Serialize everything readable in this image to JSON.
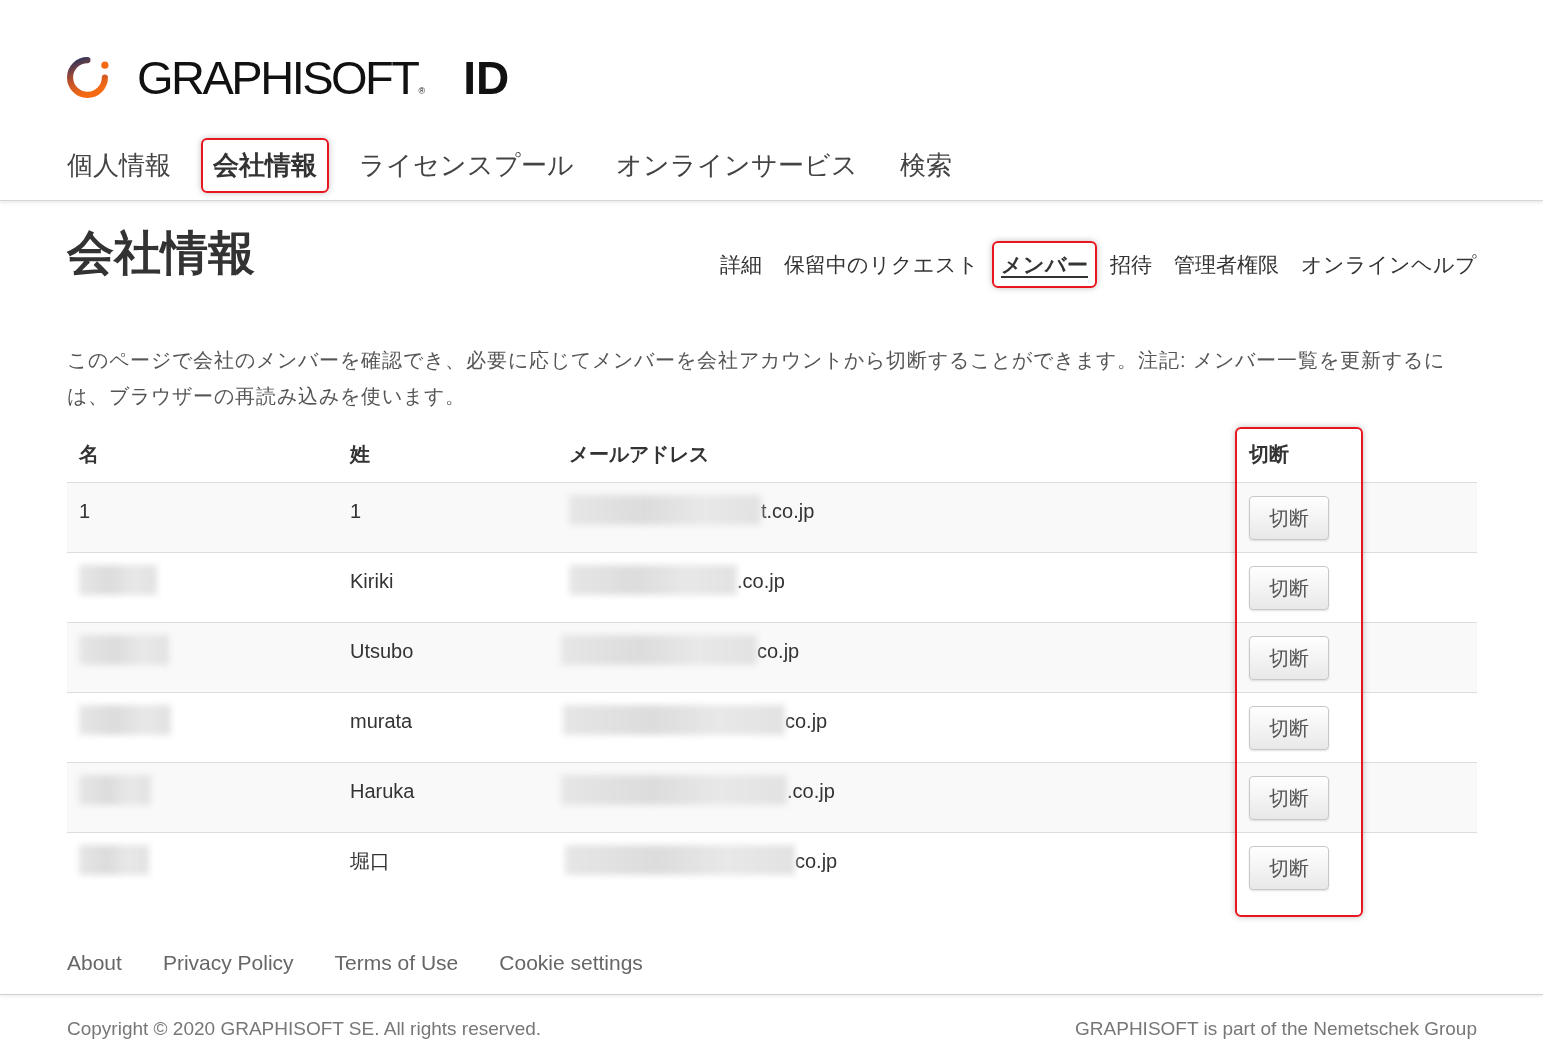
{
  "header": {
    "logo": {
      "wordmark": "GRAPHISOFT",
      "registered_mark": "®",
      "suffix": "ID"
    }
  },
  "nav_tabs": [
    {
      "label": "個人情報",
      "selected": false,
      "highlighted": false
    },
    {
      "label": "会社情報",
      "selected": true,
      "highlighted": true
    },
    {
      "label": "ライセンスプール",
      "selected": false,
      "highlighted": false
    },
    {
      "label": "オンラインサービス",
      "selected": false,
      "highlighted": false
    },
    {
      "label": "検索",
      "selected": false,
      "highlighted": false
    }
  ],
  "page": {
    "title": "会社情報",
    "subnav": [
      {
        "label": "詳細",
        "selected": false,
        "highlighted": false
      },
      {
        "label": "保留中のリクエスト",
        "selected": false,
        "highlighted": false
      },
      {
        "label": "メンバー",
        "selected": true,
        "highlighted": true
      },
      {
        "label": "招待",
        "selected": false,
        "highlighted": false
      },
      {
        "label": "管理者権限",
        "selected": false,
        "highlighted": false
      },
      {
        "label": "オンラインヘルプ",
        "selected": false,
        "highlighted": false
      }
    ],
    "description": "このページで会社のメンバーを確認でき、必要に応じてメンバーを会社アカウントから切断することができます。注記: メンバー一覧を更新するには、ブラウザーの再読み込みを使います。"
  },
  "members_table": {
    "columns": [
      {
        "label": "名",
        "highlighted": false
      },
      {
        "label": "姓",
        "highlighted": false
      },
      {
        "label": "メールアドレス",
        "highlighted": false
      },
      {
        "label": "切断",
        "highlighted": true
      }
    ],
    "rows": [
      {
        "first_name": {
          "text": "1",
          "redacted": false
        },
        "last_name": "1",
        "email": {
          "text": "t.co.jp",
          "redacted": true
        },
        "action": "切断"
      },
      {
        "first_name": {
          "redacted": true
        },
        "last_name": "Kiriki",
        "email": {
          "text": ".co.jp",
          "redacted": true
        },
        "action": "切断"
      },
      {
        "first_name": {
          "redacted": true
        },
        "last_name": "Utsubo",
        "email": {
          "text": "co.jp",
          "redacted": true
        },
        "action": "切断"
      },
      {
        "first_name": {
          "redacted": true
        },
        "last_name": "murata",
        "email": {
          "text": "co.jp",
          "redacted": true
        },
        "action": "切断"
      },
      {
        "first_name": {
          "redacted": true
        },
        "last_name": "Haruka",
        "email": {
          "text": ".co.jp",
          "redacted": true
        },
        "action": "切断"
      },
      {
        "first_name": {
          "redacted": true
        },
        "last_name": "堀口",
        "email": {
          "text": "co.jp",
          "redacted": true
        },
        "action": "切断"
      }
    ]
  },
  "footer": {
    "links": [
      "About",
      "Privacy Policy",
      "Terms of Use",
      "Cookie settings"
    ],
    "copyright": "Copyright © 2020 GRAPHISOFT SE. All rights reserved.",
    "group_note": "GRAPHISOFT is part of the Nemetschek Group"
  }
}
